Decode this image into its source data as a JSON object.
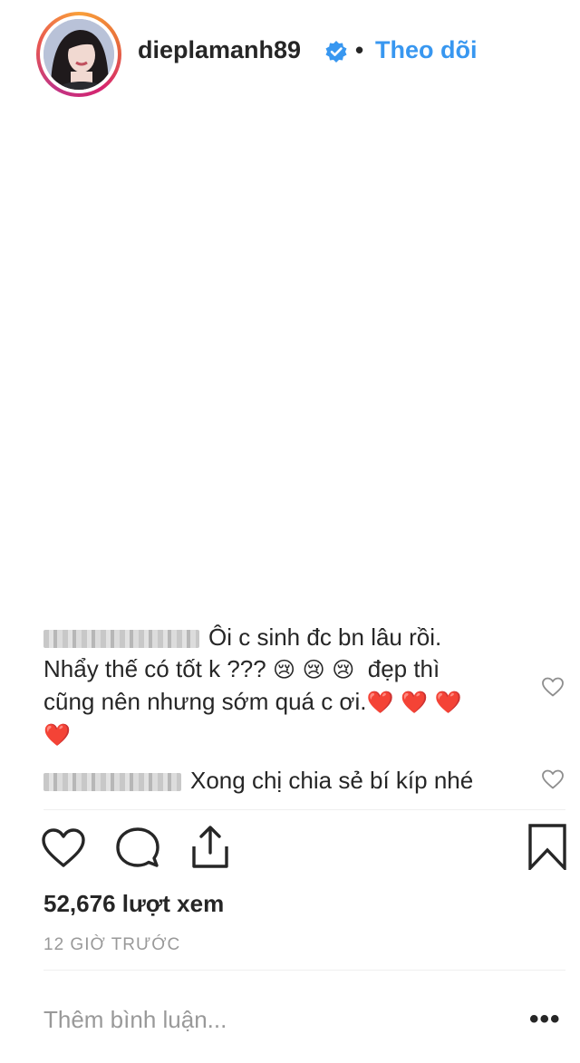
{
  "header": {
    "username": "dieplamanh89",
    "separator": "•",
    "follow_label": "Theo dõi"
  },
  "comments": [
    {
      "line1": "Ôi c sinh đc bn lâu rồi.",
      "line2a": "Nhẩy thế có tốt k ???",
      "line2_emojis": "😢 😢 😢",
      "line2b": "đẹp thì",
      "line3": "cũng nên nhưng sớm quá c ơi.",
      "line3_emojis": "❤️ ❤️ ❤️",
      "line4_emojis": "❤️"
    },
    {
      "text": "Xong chị chia sẻ bí kíp nhé"
    }
  ],
  "stats": {
    "views": "52,676 lượt xem",
    "time": "12 GIỜ TRƯỚC"
  },
  "composer": {
    "placeholder": "Thêm bình luận...",
    "more": "•••"
  },
  "colors": {
    "link": "#3897f0",
    "verified": "#3897f0",
    "emoji_heart": "#e0245e"
  },
  "icons": [
    "verified-badge-icon",
    "heart-icon",
    "comment-icon",
    "share-icon",
    "bookmark-icon",
    "ellipsis-icon"
  ]
}
